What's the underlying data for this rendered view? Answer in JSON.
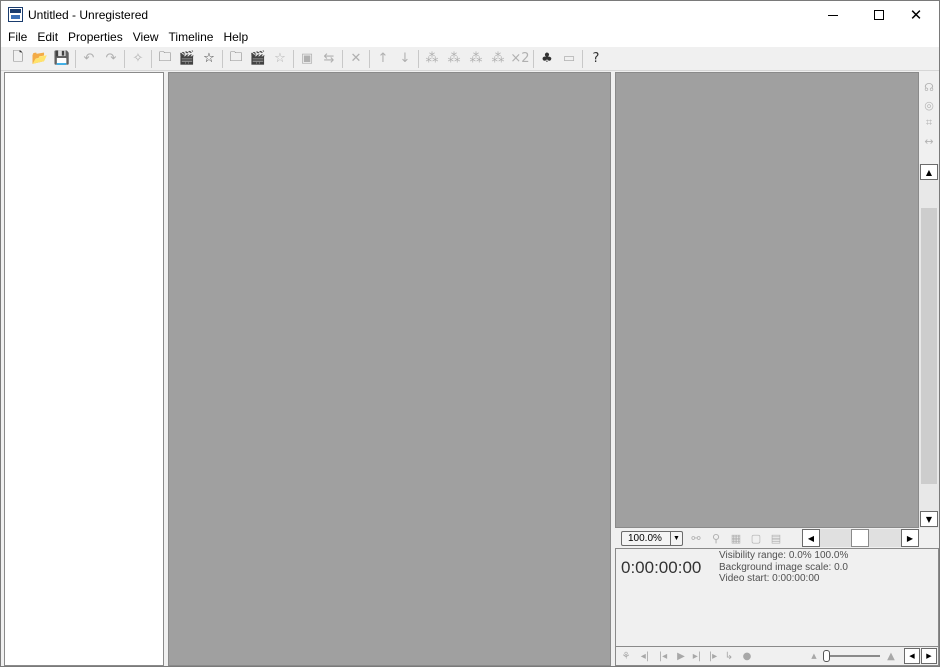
{
  "window": {
    "title": "Untitled - Unregistered",
    "minimize_glyph": "",
    "close_glyph": "✕"
  },
  "menu": [
    "File",
    "Edit",
    "Properties",
    "View",
    "Timeline",
    "Help"
  ],
  "toolbar": {
    "new_icon": "🗋",
    "open_icon": "📂",
    "save_icon": "💾",
    "undo_icon": "↶",
    "redo_icon": "↷",
    "magic_icon": "✧",
    "folder_icon": "🗀",
    "scene_icon": "🎬",
    "star_icon": "☆",
    "add_folder_icon": "🗀",
    "add_scene_icon": "🎬",
    "add_star_icon": "☆",
    "image_folder_icon": "▣",
    "flip_icon": "⇆",
    "delete_icon": "✕",
    "up_icon": "↑",
    "down_icon": "↓",
    "node1_icon": "⁂",
    "node2_icon": "⁂",
    "node3_icon": "⁂",
    "node4_icon": "⁂",
    "times2_label": "×2",
    "leaf_icon": "♣",
    "picture_icon": "▭",
    "help_icon": "?"
  },
  "right_tools": [
    "☊",
    "◎",
    "⌗",
    "↔"
  ],
  "scroll": {
    "up": "▲",
    "down": "▼",
    "left": "◀",
    "right": "▶"
  },
  "zoom": {
    "value": "100.0%",
    "arrow": "▼",
    "tools": [
      "⚯",
      "⚲",
      "▦",
      "▢",
      "▤"
    ]
  },
  "info": {
    "timecode": "0:00:00:00",
    "visibility_range": "Visibility range: 0.0%  100.0%",
    "background_scale": "Background image scale: 0.0",
    "video_start": "Video start: 0:00:00:00"
  },
  "playback": {
    "buttons": [
      "⚘",
      "◂|",
      "|◂",
      "▶",
      "▸|",
      "|▸",
      "↳",
      "●"
    ],
    "vol_low": "▲",
    "vol_high": "▲"
  }
}
